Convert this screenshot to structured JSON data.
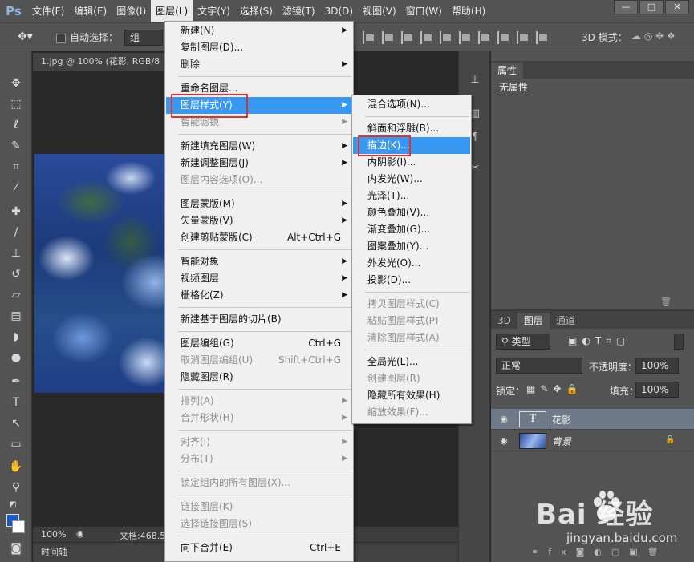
{
  "app": {
    "logo": "Ps",
    "menu": [
      "文件(F)",
      "编辑(E)",
      "图像(I)",
      "图层(L)",
      "文字(Y)",
      "选择(S)",
      "滤镜(T)",
      "3D(D)",
      "视图(V)",
      "窗口(W)",
      "帮助(H)"
    ],
    "active_menu": "图层(L)",
    "window_controls": [
      "—",
      "□",
      "✕"
    ]
  },
  "options_bar": {
    "auto_select_label": "自动选择：",
    "auto_select_value": "组",
    "mode_3d_label": "3D 模式："
  },
  "document": {
    "tab_title": "1.jpg @ 100% (花影, RGB/8",
    "zoom": "100%",
    "doc_info": "文档:468.5",
    "timeline_label": "时间轴"
  },
  "properties_panel": {
    "tab": "属性",
    "empty_text": "无属性"
  },
  "layers_panel": {
    "tabs": [
      "3D",
      "图层",
      "通道"
    ],
    "active_tab": "图层",
    "filter_label": "类型",
    "blend_mode": "正常",
    "opacity_label": "不透明度：",
    "opacity_value": "100%",
    "lock_label": "锁定：",
    "fill_label": "填充：",
    "fill_value": "100%",
    "layers": [
      {
        "name": "花影",
        "kind": "text",
        "selected": true
      },
      {
        "name": "背景",
        "kind": "image",
        "locked": true
      }
    ],
    "text_thumb": "T"
  },
  "layer_menu": {
    "items": [
      {
        "label": "新建(N)",
        "submenu": true
      },
      {
        "label": "复制图层(D)..."
      },
      {
        "label": "删除",
        "submenu": true
      },
      {
        "sep": true
      },
      {
        "label": "重命名图层..."
      },
      {
        "label": "图层样式(Y)",
        "submenu": true,
        "highlighted": true
      },
      {
        "label": "智能滤镜",
        "disabled": true,
        "submenu": true
      },
      {
        "sep": true
      },
      {
        "label": "新建填充图层(W)",
        "submenu": true
      },
      {
        "label": "新建调整图层(J)",
        "submenu": true
      },
      {
        "label": "图层内容选项(O)...",
        "disabled": true
      },
      {
        "sep": true
      },
      {
        "label": "图层蒙版(M)",
        "submenu": true
      },
      {
        "label": "矢量蒙版(V)",
        "submenu": true
      },
      {
        "label": "创建剪贴蒙版(C)",
        "shortcut": "Alt+Ctrl+G"
      },
      {
        "sep": true
      },
      {
        "label": "智能对象",
        "submenu": true
      },
      {
        "label": "视频图层",
        "submenu": true
      },
      {
        "label": "栅格化(Z)",
        "submenu": true
      },
      {
        "sep": true
      },
      {
        "label": "新建基于图层的切片(B)"
      },
      {
        "sep": true
      },
      {
        "label": "图层编组(G)",
        "shortcut": "Ctrl+G"
      },
      {
        "label": "取消图层编组(U)",
        "shortcut": "Shift+Ctrl+G",
        "disabled": true
      },
      {
        "label": "隐藏图层(R)"
      },
      {
        "sep": true
      },
      {
        "label": "排列(A)",
        "submenu": true,
        "disabled": true
      },
      {
        "label": "合并形状(H)",
        "submenu": true,
        "disabled": true
      },
      {
        "sep": true
      },
      {
        "label": "对齐(I)",
        "submenu": true,
        "disabled": true
      },
      {
        "label": "分布(T)",
        "submenu": true,
        "disabled": true
      },
      {
        "sep": true
      },
      {
        "label": "锁定组内的所有图层(X)...",
        "disabled": true
      },
      {
        "sep": true
      },
      {
        "label": "链接图层(K)",
        "disabled": true
      },
      {
        "label": "选择链接图层(S)",
        "disabled": true
      },
      {
        "sep": true
      },
      {
        "label": "向下合并(E)",
        "shortcut": "Ctrl+E"
      }
    ]
  },
  "style_submenu": {
    "items": [
      {
        "label": "混合选项(N)..."
      },
      {
        "sep": true
      },
      {
        "label": "斜面和浮雕(B)..."
      },
      {
        "label": "描边(K)...",
        "highlighted": true
      },
      {
        "label": "内阴影(I)..."
      },
      {
        "label": "内发光(W)..."
      },
      {
        "label": "光泽(T)..."
      },
      {
        "label": "颜色叠加(V)..."
      },
      {
        "label": "渐变叠加(G)..."
      },
      {
        "label": "图案叠加(Y)..."
      },
      {
        "label": "外发光(O)..."
      },
      {
        "label": "投影(D)..."
      },
      {
        "sep": true
      },
      {
        "label": "拷贝图层样式(C)",
        "disabled": true
      },
      {
        "label": "粘贴图层样式(P)",
        "disabled": true
      },
      {
        "label": "清除图层样式(A)",
        "disabled": true
      },
      {
        "sep": true
      },
      {
        "label": "全局光(L)..."
      },
      {
        "label": "创建图层(R)",
        "disabled": true
      },
      {
        "label": "隐藏所有效果(H)"
      },
      {
        "label": "缩放效果(F)...",
        "disabled": true
      }
    ]
  },
  "watermark": {
    "brand": "Bai  经验",
    "url": "jingyan.baidu.com"
  },
  "colors": {
    "menu_highlight": "#3999f2",
    "annotation_red": "#e0312a",
    "foreground": "#1d58b8",
    "background": "#ffffff"
  }
}
